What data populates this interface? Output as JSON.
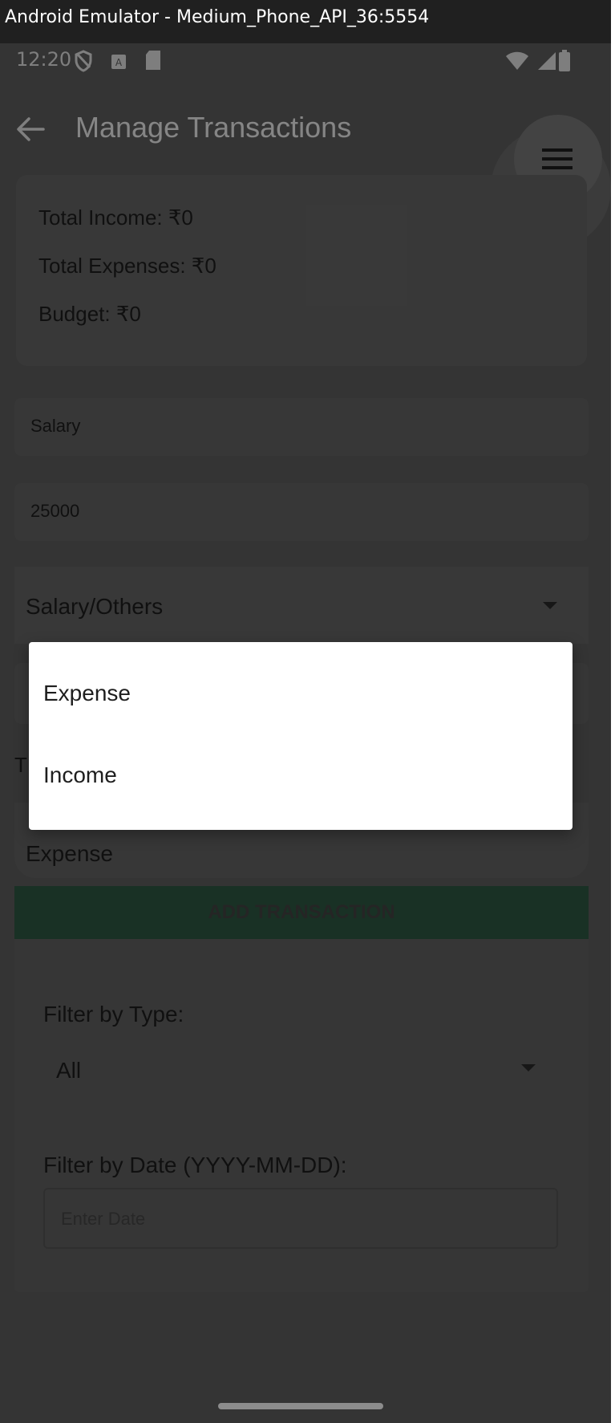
{
  "window": {
    "title": "Android Emulator - Medium_Phone_API_36:5554"
  },
  "status_bar": {
    "time": "12:20",
    "icons": [
      "shield-icon",
      "keyboard-icon",
      "sdcard-icon",
      "wifi-icon",
      "signal-icon",
      "battery-icon"
    ]
  },
  "app_bar": {
    "title": "Manage Transactions",
    "back_icon": "arrow-back-icon",
    "menu_icon": "hamburger-menu-icon"
  },
  "summary": {
    "total_income": "Total Income: ₹0",
    "total_expenses": "Total Expenses: ₹0",
    "budget": "Budget: ₹0"
  },
  "form": {
    "title_value": "Salary",
    "amount_value": "25000",
    "category_value": "Salary/Others",
    "type_label_partial": "T",
    "type_value": "Expense",
    "add_button_label": "ADD TRANSACTION"
  },
  "filters": {
    "type_label": "Filter by Type:",
    "type_value": "All",
    "date_label": "Filter by Date (YYYY-MM-DD):",
    "date_placeholder": "Enter Date"
  },
  "type_dropdown": {
    "options": [
      "Expense",
      "Income"
    ]
  },
  "colors": {
    "dialog_bg": "#ffffff",
    "button_green": "#2e5a44",
    "scrim": "rgba(0,0,0,0.45)"
  }
}
